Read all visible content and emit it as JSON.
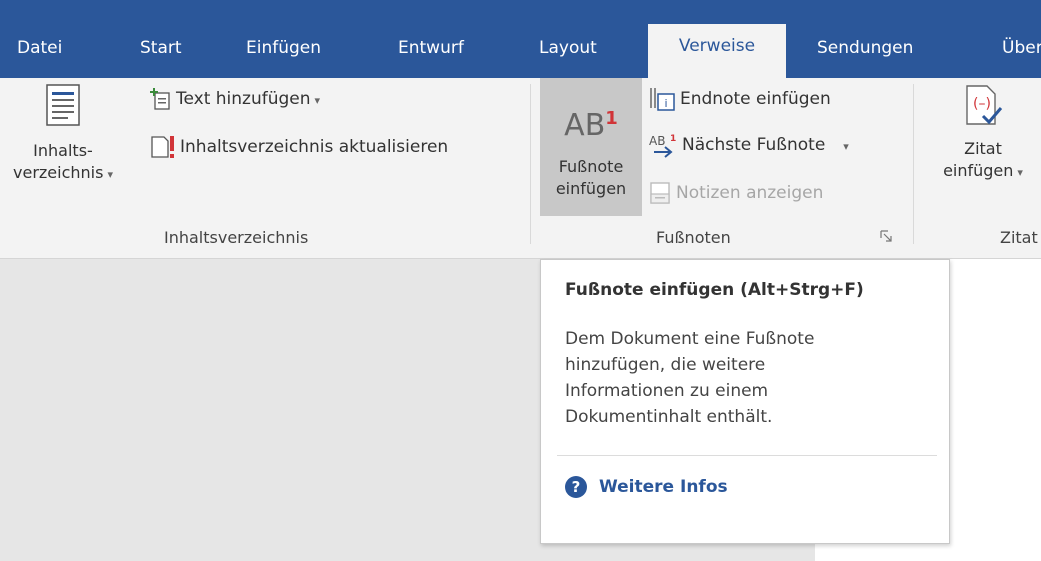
{
  "tabs": [
    {
      "label": "Datei"
    },
    {
      "label": "Start"
    },
    {
      "label": "Einfügen"
    },
    {
      "label": "Entwurf"
    },
    {
      "label": "Layout"
    },
    {
      "label": "Verweise",
      "active": true
    },
    {
      "label": "Sendungen"
    },
    {
      "label": "Über"
    }
  ],
  "groups": {
    "toc": {
      "label": "Inhaltsverzeichnis",
      "big_button": {
        "line1": "Inhalts-",
        "line2": "verzeichnis",
        "icon": "document-lines-icon"
      },
      "add_text": "Text hinzufügen",
      "update": "Inhaltsverzeichnis aktualisieren"
    },
    "footnotes": {
      "label": "Fußnoten",
      "big_button": {
        "line1": "Fußnote",
        "line2": "einfügen",
        "icon_text": "AB",
        "icon_sup": "1"
      },
      "endnote": "Endnote einfügen",
      "next": "Nächste Fußnote",
      "notes": "Notizen anzeigen"
    },
    "citations": {
      "label": "Zitat",
      "big_button": {
        "line1": "Zitat",
        "line2": "einfügen"
      }
    }
  },
  "tooltip": {
    "title": "Fußnote einfügen (Alt+Strg+F)",
    "lines": [
      "Dem Dokument eine Fußnote",
      "hinzufügen, die weitere",
      "Informationen zu einem",
      "Dokumentinhalt enthält."
    ],
    "help": "Weitere Infos"
  },
  "colors": {
    "brand": "#2b579a",
    "ribbon": "#f3f3f3",
    "hover": "#c8c8c8",
    "red_accent": "#d13438"
  }
}
